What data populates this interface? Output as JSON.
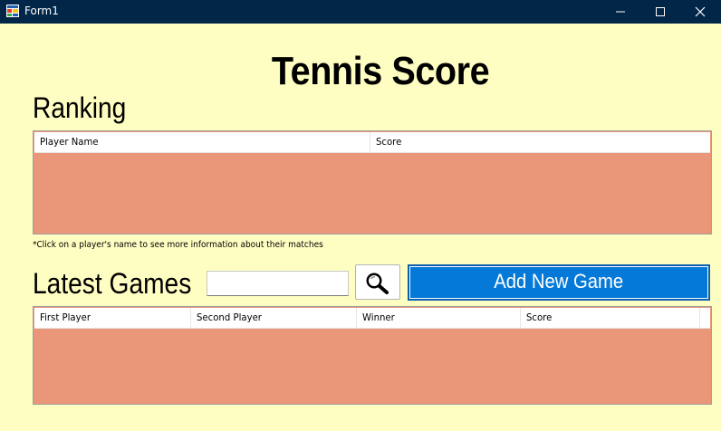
{
  "window": {
    "title": "Form1",
    "controls": [
      "minimize-icon",
      "maximize-icon",
      "close-icon"
    ]
  },
  "page": {
    "title": "Tennis Score"
  },
  "ranking": {
    "title": "Ranking",
    "columns": [
      "Player Name",
      "Score"
    ],
    "rows": [],
    "hint": "*Click on a player's name to see more information about their matches"
  },
  "games": {
    "title": "Latest Games",
    "search_value": "",
    "search_icon": "magnifier-icon",
    "add_button_label": "Add New Game",
    "columns": [
      "First Player",
      "Second Player",
      "Winner",
      "Score"
    ],
    "rows": []
  },
  "colors": {
    "background": "#fffec2",
    "titlebar": "#012648",
    "grid_background": "#e99679",
    "accent_button": "#0579d8"
  }
}
